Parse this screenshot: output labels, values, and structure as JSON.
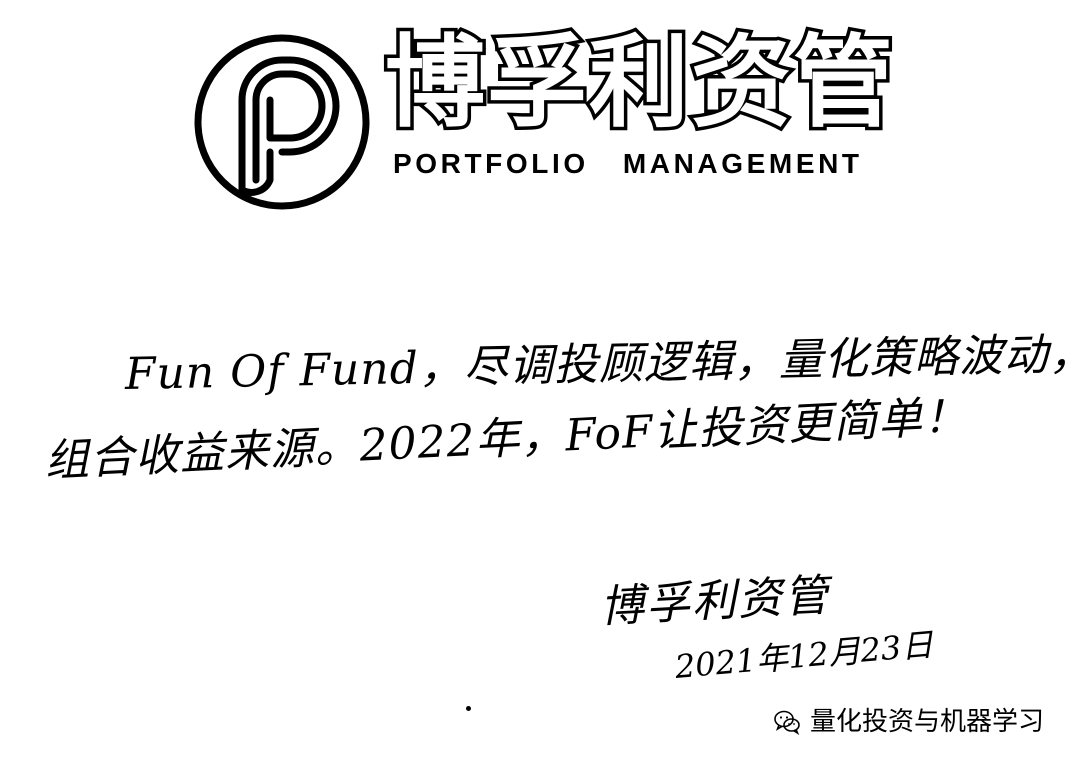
{
  "header": {
    "brand_cn": "博孚利资管",
    "brand_en": "PORTFOLIO   MANAGEMENT",
    "logo_icon": "portfolio-p-ring-icon"
  },
  "message": {
    "line1": "Fun Of Fund，尽调投顾逻辑，量化策略波动，",
    "line2": "组合收益来源。2022年，FoF让投资更简单！"
  },
  "signature": {
    "name": "博孚利资管",
    "date": "2021年12月23日"
  },
  "watermark": {
    "icon": "wechat-icon",
    "text": "量化投资与机器学习"
  },
  "colors": {
    "ink": "#000000",
    "paper": "#ffffff"
  }
}
